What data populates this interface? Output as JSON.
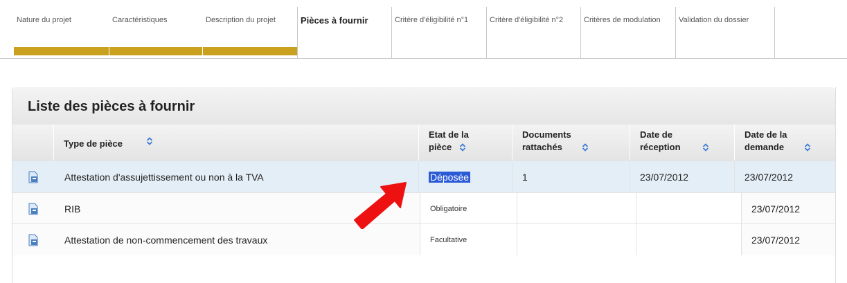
{
  "tabs": [
    {
      "label": "Nature du projet",
      "state": "done"
    },
    {
      "label": "Caractéristiques",
      "state": "done"
    },
    {
      "label": "Description du projet",
      "state": "done"
    },
    {
      "label": "Pièces à fournir",
      "state": "active"
    },
    {
      "label": "Critère d'éligibilité n°1",
      "state": "todo"
    },
    {
      "label": "Critère d'éligibilité n°2",
      "state": "todo"
    },
    {
      "label": "Critères de modulation",
      "state": "todo"
    },
    {
      "label": "Validation du dossier",
      "state": "todo"
    },
    {
      "label": "",
      "state": "todo"
    }
  ],
  "panel": {
    "title": "Liste des pièces à fournir",
    "columns": [
      {
        "label_line1": "Type de pièce",
        "label_line2": ""
      },
      {
        "label_line1": "Etat de la",
        "label_line2": "pièce"
      },
      {
        "label_line1": "Documents",
        "label_line2": "rattachés"
      },
      {
        "label_line1": "Date de",
        "label_line2": "réception"
      },
      {
        "label_line1": "Date de la",
        "label_line2": "demande"
      }
    ],
    "rows": [
      {
        "type": "Attestation d'assujettissement ou non à la TVA",
        "etat": "Déposée",
        "documents": "1",
        "reception": "23/07/2012",
        "demande": "23/07/2012"
      },
      {
        "type": "RIB",
        "etat": "Obligatoire",
        "documents": "",
        "reception": "",
        "demande": "23/07/2012"
      },
      {
        "type": "Attestation de non-commencement des travaux",
        "etat": "Facultative",
        "documents": "",
        "reception": "",
        "demande": "23/07/2012"
      }
    ]
  },
  "colors": {
    "progress_done": "#c9a11e",
    "row_highlight": "#e4eef6",
    "selection": "#2b5ad6",
    "arrow": "#ee1111",
    "sort_icon": "#3a7bd5"
  },
  "icons": {
    "row_icon": "document-icon",
    "sort_icon": "sort-up-down-icon",
    "annotation": "red-arrow"
  }
}
